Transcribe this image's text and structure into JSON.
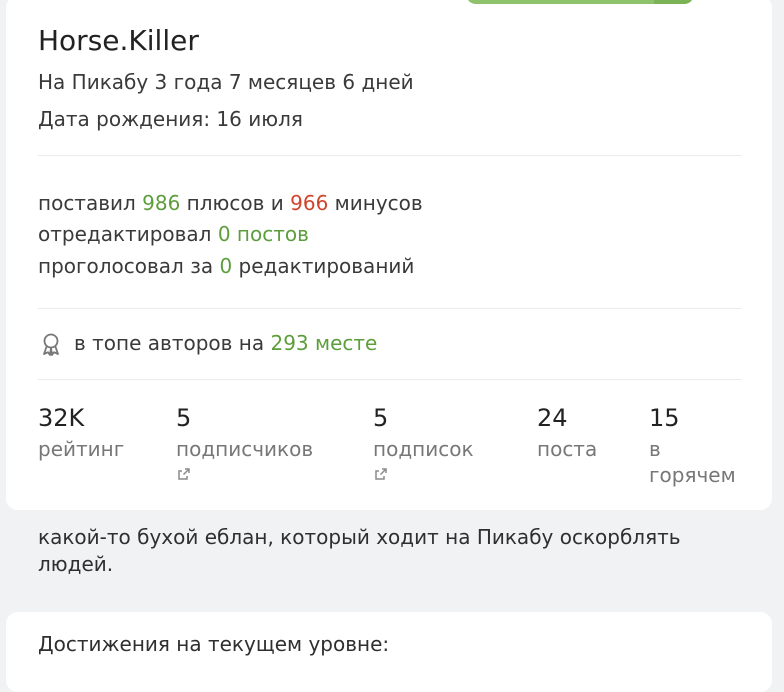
{
  "profile": {
    "nickname": "Horse.Killer",
    "on_site": "На Пикабу 3 года 7 месяцев 6 дней",
    "birthday": "Дата рождения: 16 июля"
  },
  "stats": {
    "line1": {
      "prefix": "поставил ",
      "pluses": "986",
      "middle": " плюсов и ",
      "minuses": "966",
      "suffix": " минусов"
    },
    "line2": {
      "prefix": "отредактировал ",
      "value": "0 постов"
    },
    "line3": {
      "prefix": "проголосовал за ",
      "value": "0",
      "suffix": " редактирований"
    }
  },
  "top": {
    "icon": "medal-icon",
    "prefix": "в топе авторов на ",
    "value": "293 месте"
  },
  "counters": [
    {
      "value": "32K",
      "label": "рейтинг"
    },
    {
      "value": "5",
      "label": "подписчиков",
      "icon": "external-link-icon"
    },
    {
      "value": "5",
      "label": "подписок",
      "icon": "external-link-icon"
    },
    {
      "value": "24",
      "label": "поста"
    },
    {
      "value": "15",
      "label_line1": "в",
      "label_line2": "горячем"
    }
  ],
  "about": "какой-то бухой еблан, который ходит на Пикабу оскорблять людей.",
  "achievements": {
    "title": "Достижения на текущем уровне:"
  },
  "colors": {
    "green": "#5d9e3c",
    "red": "#d0442c",
    "button_green": "#8ec26c"
  }
}
